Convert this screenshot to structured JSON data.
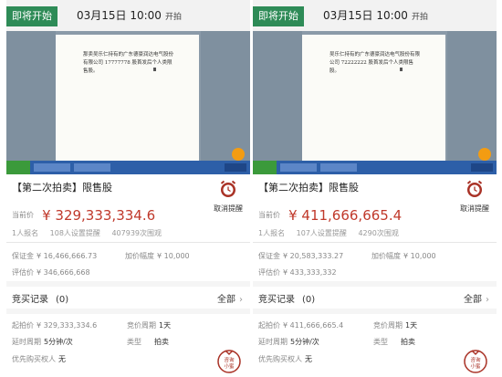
{
  "colors": {
    "brand_green": "#2e8b57",
    "price_red": "#c0392b",
    "alarm_red": "#a93226"
  },
  "panels": [
    {
      "tag": "即将开始",
      "start_date_time": "03月15日 10:00",
      "start_suffix": "开拍",
      "doc_text": "那卖吴乐仁持有的广东德豪润达电气股份有限公司 17777778 股首发后个人类限售股。",
      "title": "【第二次拍卖】限售股",
      "reminder_label": "取消提醒",
      "current_price_label": "当前价",
      "current_price": "¥ 329,333,334.6",
      "signups": "1人报名",
      "reminders": "108人设置提醒",
      "views": "407939次围观",
      "deposit_label": "保证金",
      "deposit": "¥ 16,466,666.73",
      "increment_label": "加价幅度",
      "increment": "¥ 10,000",
      "appraisal_label": "评估价",
      "appraisal": "¥ 346,666,668",
      "bids_label": "竞买记录",
      "bids_count": "(0)",
      "all_label": "全部",
      "start_price_label": "起拍价",
      "start_price": "¥ 329,333,334.6",
      "cycle_label": "竞价周期",
      "cycle": "1天",
      "delay_label": "延时周期",
      "delay": "5分钟/次",
      "type_label": "类型",
      "type": "拍卖",
      "priority_label": "优先购买权人",
      "priority": "无",
      "consult_label": "咨询小蜜"
    },
    {
      "tag": "即将开始",
      "start_date_time": "03月15日 10:00",
      "start_suffix": "开拍",
      "doc_text": "吴乐仁持有的广东德豪润达电气股份有限公司 72222222 股首发后个人类限售股。",
      "title": "【第二次拍卖】限售股",
      "reminder_label": "取消提醒",
      "current_price_label": "当前价",
      "current_price": "¥ 411,666,665.4",
      "signups": "1人报名",
      "reminders": "107人设置提醒",
      "views": "4290次围观",
      "deposit_label": "保证金",
      "deposit": "¥ 20,583,333.27",
      "increment_label": "加价幅度",
      "increment": "¥ 10,000",
      "appraisal_label": "评估价",
      "appraisal": "¥ 433,333,332",
      "bids_label": "竞买记录",
      "bids_count": "(0)",
      "all_label": "全部",
      "start_price_label": "起拍价",
      "start_price": "¥ 411,666,665.4",
      "cycle_label": "竞价周期",
      "cycle": "1天",
      "delay_label": "延时周期",
      "delay": "5分钟/次",
      "type_label": "类型",
      "type": "拍卖",
      "priority_label": "优先购买权人",
      "priority": "无",
      "consult_label": "咨询小蜜"
    }
  ]
}
